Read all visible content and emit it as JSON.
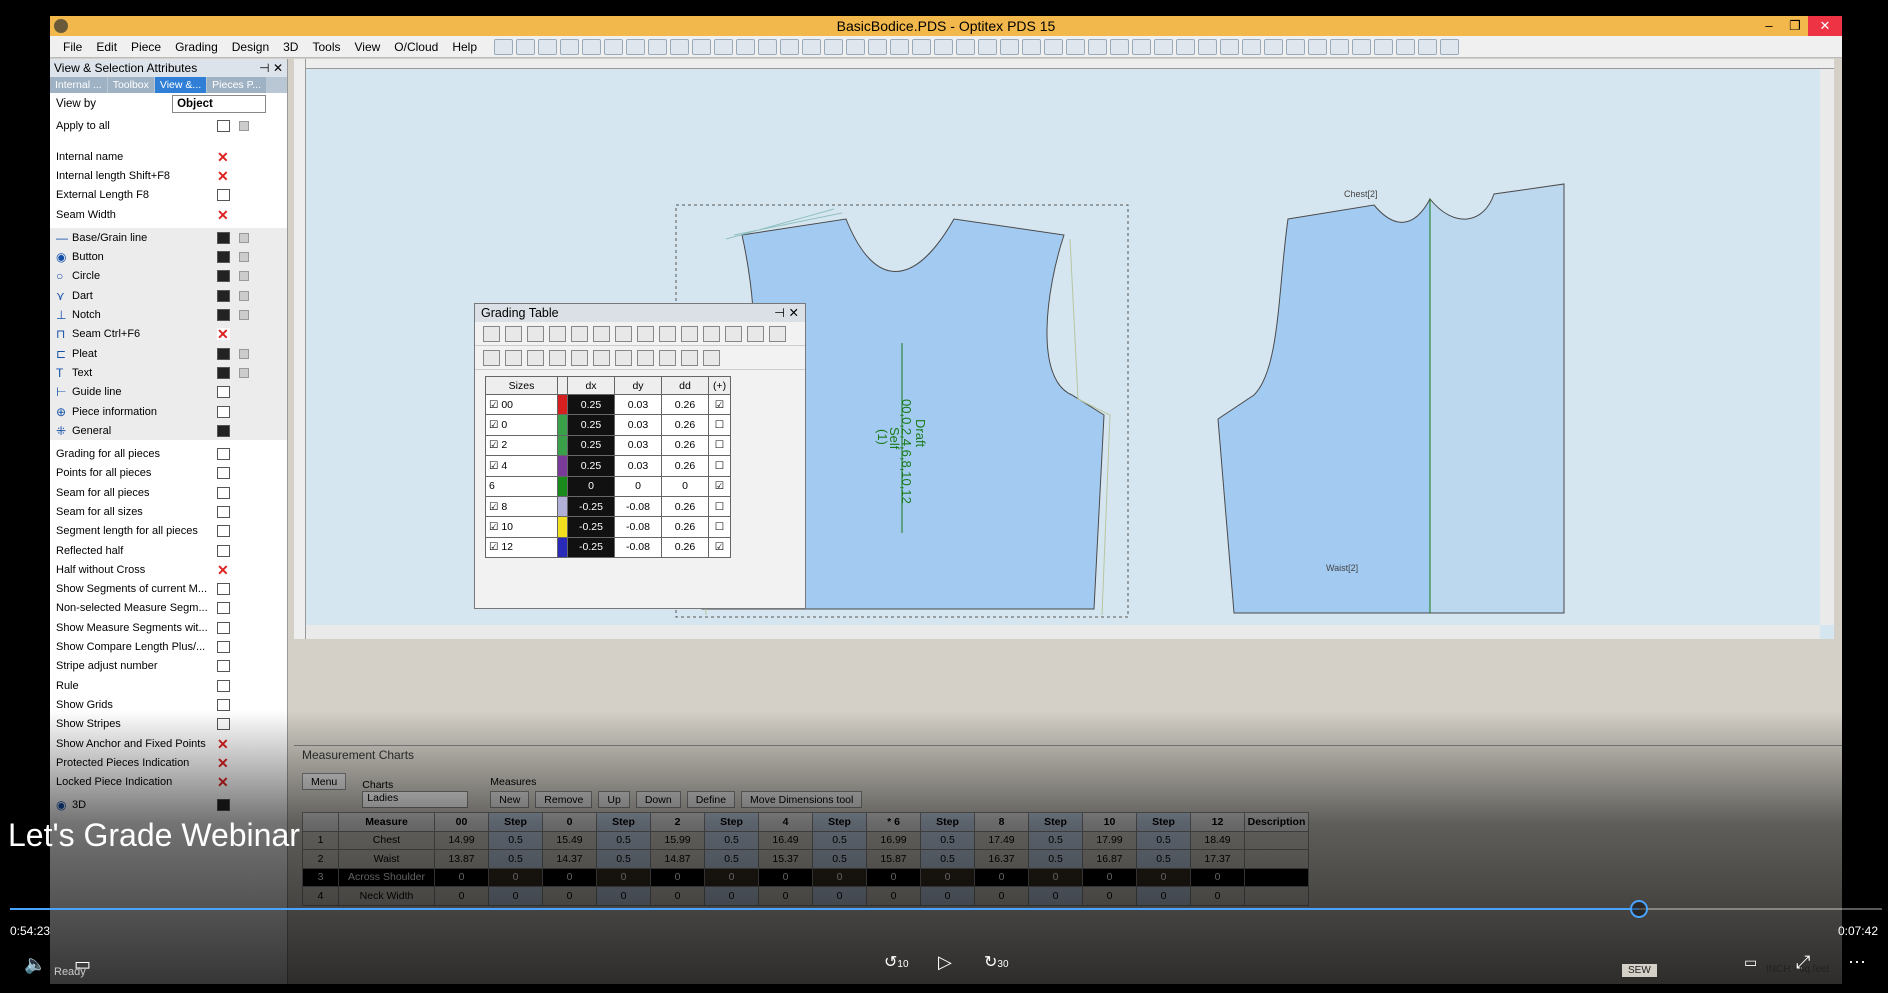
{
  "titlebar": {
    "title": "BasicBodice.PDS - Optitex PDS 15"
  },
  "menu": [
    "File",
    "Edit",
    "Piece",
    "Grading",
    "Design",
    "3D",
    "Tools",
    "View",
    "O/Cloud",
    "Help"
  ],
  "panel": {
    "title": "View & Selection Attributes",
    "tabs": [
      "Internal ...",
      "Toolbox",
      "View &...",
      "Pieces P..."
    ],
    "view_by_label": "View by",
    "view_by_value": "Object",
    "apply_all": "Apply to all",
    "items": [
      {
        "label": "Internal name",
        "icon": "x"
      },
      {
        "label": "Internal length   Shift+F8",
        "icon": "x"
      },
      {
        "label": "External Length   F8",
        "icon": "eye"
      },
      {
        "label": "Seam Width",
        "icon": "x"
      },
      {
        "label": "Base/Grain line",
        "icon": "blk",
        "sym": "—"
      },
      {
        "label": "Button",
        "icon": "blk",
        "sym": "◉"
      },
      {
        "label": "Circle",
        "icon": "blk",
        "sym": "○"
      },
      {
        "label": "Dart",
        "icon": "blk",
        "sym": "⋎"
      },
      {
        "label": "Notch",
        "icon": "blk",
        "sym": "⊥"
      },
      {
        "label": "Seam   Ctrl+F6",
        "icon": "x",
        "sym": "⊓"
      },
      {
        "label": "Pleat",
        "icon": "blk",
        "sym": "⊏"
      },
      {
        "label": "Text",
        "icon": "blk",
        "sym": "T"
      },
      {
        "label": "Guide line",
        "icon": "eye",
        "sym": "⊢"
      },
      {
        "label": "Piece information",
        "icon": "eye",
        "sym": "⊕"
      },
      {
        "label": "General",
        "icon": "blk",
        "sym": "⁜"
      },
      {
        "label": "Grading for all pieces",
        "icon": "eye"
      },
      {
        "label": "Points for all pieces",
        "icon": "eye"
      },
      {
        "label": "Seam for all pieces",
        "icon": "eye"
      },
      {
        "label": "Seam for all sizes",
        "icon": "eye"
      },
      {
        "label": "Segment length for all pieces",
        "icon": "eye"
      },
      {
        "label": "Reflected half",
        "icon": "eye"
      },
      {
        "label": "Half without Cross",
        "icon": "x"
      },
      {
        "label": "Show Segments of current M...",
        "icon": "eye"
      },
      {
        "label": "Non-selected Measure Segm...",
        "icon": "eye"
      },
      {
        "label": "Show Measure Segments wit...",
        "icon": "eye"
      },
      {
        "label": "Show Compare Length Plus/...",
        "icon": "eye"
      },
      {
        "label": "Stripe adjust number",
        "icon": "eye"
      },
      {
        "label": "Rule",
        "icon": "eye"
      },
      {
        "label": "Show Grids",
        "icon": "eye"
      },
      {
        "label": "Show Stripes",
        "icon": "eye"
      },
      {
        "label": "Show Anchor and Fixed Points",
        "icon": "x"
      },
      {
        "label": "Protected Pieces Indication",
        "icon": "x"
      },
      {
        "label": "Locked Piece Indication",
        "icon": "x"
      },
      {
        "label": "3D",
        "icon": "blk",
        "sym": "◉"
      }
    ]
  },
  "grading_table": {
    "title": "Grading Table",
    "headers": [
      "Sizes",
      "dx",
      "dy",
      "dd",
      "(+)"
    ],
    "rows": [
      {
        "size": "☑ 00",
        "color": "#d62020",
        "dx": "0.25",
        "dy": "0.03",
        "dd": "0.26",
        "chk": "☑"
      },
      {
        "size": "☑ 0",
        "color": "#3aa04a",
        "dx": "0.25",
        "dy": "0.03",
        "dd": "0.26",
        "chk": "☐"
      },
      {
        "size": "☑ 2",
        "color": "#3aa04a",
        "dx": "0.25",
        "dy": "0.03",
        "dd": "0.26",
        "chk": "☐"
      },
      {
        "size": "☑ 4",
        "color": "#7a3a9a",
        "dx": "0.25",
        "dy": "0.03",
        "dd": "0.26",
        "chk": "☐"
      },
      {
        "size": "6",
        "color": "#1a8a1a",
        "dx": "0",
        "dy": "0",
        "dd": "0",
        "chk": "☑"
      },
      {
        "size": "☑ 8",
        "color": "#b0b0d8",
        "dx": "-0.25",
        "dy": "-0.08",
        "dd": "0.26",
        "chk": "☐"
      },
      {
        "size": "☑ 10",
        "color": "#f2e020",
        "dx": "-0.25",
        "dy": "-0.08",
        "dd": "0.26",
        "chk": "☐"
      },
      {
        "size": "☑ 12",
        "color": "#2a2ab8",
        "dx": "-0.25",
        "dy": "-0.08",
        "dd": "0.26",
        "chk": "☑"
      }
    ]
  },
  "canvas": {
    "piece_label_1": "Draft",
    "piece_label_2": "00,0,2,4,6,8,10,12",
    "piece_label_3": "Self",
    "piece_label_4": "(1)",
    "chest_label": "Chest[2]",
    "waist_label": "Waist[2]"
  },
  "measure": {
    "title": "Measurement Charts",
    "menu_btn": "Menu",
    "charts_label": "Charts",
    "charts_value": "Ladies",
    "measures_label": "Measures",
    "buttons": [
      "New",
      "Remove",
      "Up",
      "Down",
      "Define",
      "Move Dimensions tool"
    ],
    "headers": [
      "",
      "Measure",
      "00",
      "Step",
      "0",
      "Step",
      "2",
      "Step",
      "4",
      "Step",
      "* 6",
      "Step",
      "8",
      "Step",
      "10",
      "Step",
      "12",
      "Description"
    ],
    "rows": [
      [
        "1",
        "Chest",
        "14.99",
        "0.5",
        "15.49",
        "0.5",
        "15.99",
        "0.5",
        "16.49",
        "0.5",
        "16.99",
        "0.5",
        "17.49",
        "0.5",
        "17.99",
        "0.5",
        "18.49",
        ""
      ],
      [
        "2",
        "Waist",
        "13.87",
        "0.5",
        "14.37",
        "0.5",
        "14.87",
        "0.5",
        "15.37",
        "0.5",
        "15.87",
        "0.5",
        "16.37",
        "0.5",
        "16.87",
        "0.5",
        "17.37",
        ""
      ],
      [
        "3",
        "Across Shoulder",
        "0",
        "0",
        "0",
        "0",
        "0",
        "0",
        "0",
        "0",
        "0",
        "0",
        "0",
        "0",
        "0",
        "0",
        "0",
        ""
      ],
      [
        "4",
        "Neck Width",
        "0",
        "0",
        "0",
        "0",
        "0",
        "0",
        "0",
        "0",
        "0",
        "0",
        "0",
        "0",
        "0",
        "0",
        "0",
        ""
      ]
    ]
  },
  "status": {
    "ready": "Ready",
    "sew": "SEW",
    "units": "INCH - sq.feet"
  },
  "video": {
    "title": "Let's Grade Webinar",
    "elapsed": "0:54:23",
    "remaining": "0:07:42",
    "progress": 0.87,
    "skip_back": "10",
    "skip_fwd": "30"
  }
}
